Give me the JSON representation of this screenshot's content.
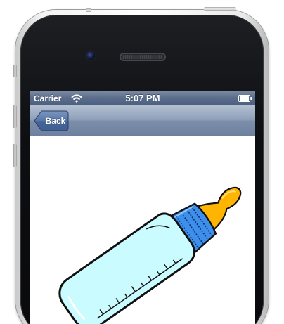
{
  "status_bar": {
    "carrier": "Carrier",
    "time": "5:07 PM",
    "wifi_icon": "wifi-icon",
    "battery_icon": "battery-icon"
  },
  "nav_bar": {
    "back_label": "Back"
  },
  "content": {
    "image_icon": "baby-bottle-icon"
  },
  "colors": {
    "status_bar": "#5b6d8b",
    "nav_bar": "#8d9fb8",
    "back_button": "#4f6a99",
    "bottle_body": "#c9fbff",
    "bottle_collar": "#3e8fea",
    "nipple": "#ffb400"
  }
}
